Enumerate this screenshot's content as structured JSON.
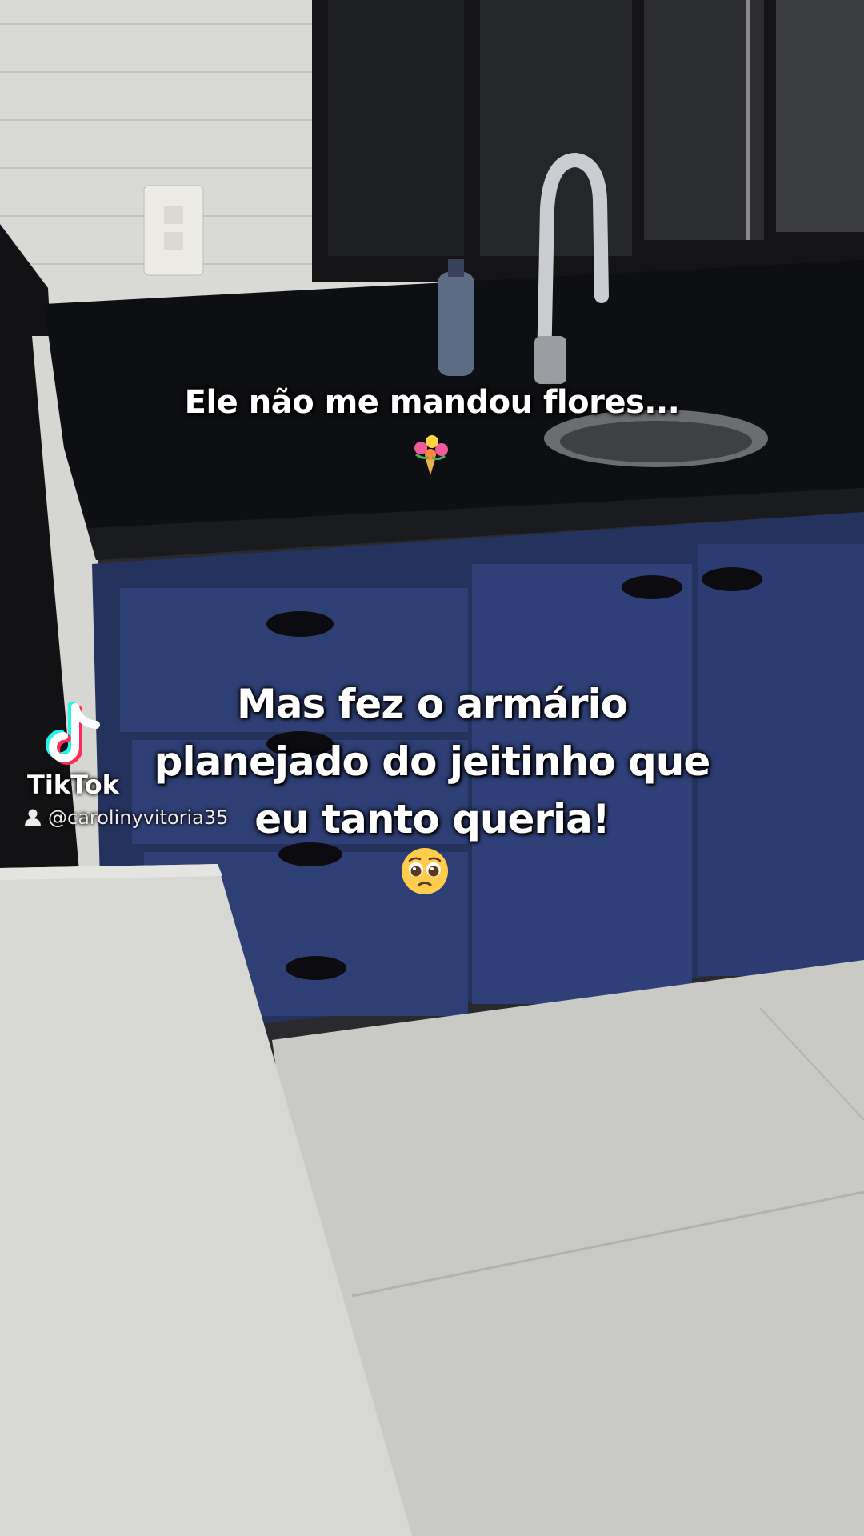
{
  "video": {
    "caption_top": "Ele não me mandou flores...",
    "emoji_top": "bouquet-emoji",
    "caption_main_lines": [
      "Mas fez o armário",
      "planejado do jeitinho que",
      "eu tanto queria!"
    ],
    "emoji_main": "pleading-face-emoji"
  },
  "watermark": {
    "brand": "TikTok",
    "username": "@carolinyvitoria35",
    "icon": "tiktok-logo-icon"
  },
  "colors": {
    "cabinet_blue": "#2e3f75",
    "countertop": "#0e0f12",
    "floor": "#c9c9c6",
    "tiktok_cyan": "#25f4ee",
    "tiktok_red": "#fe2c55"
  }
}
